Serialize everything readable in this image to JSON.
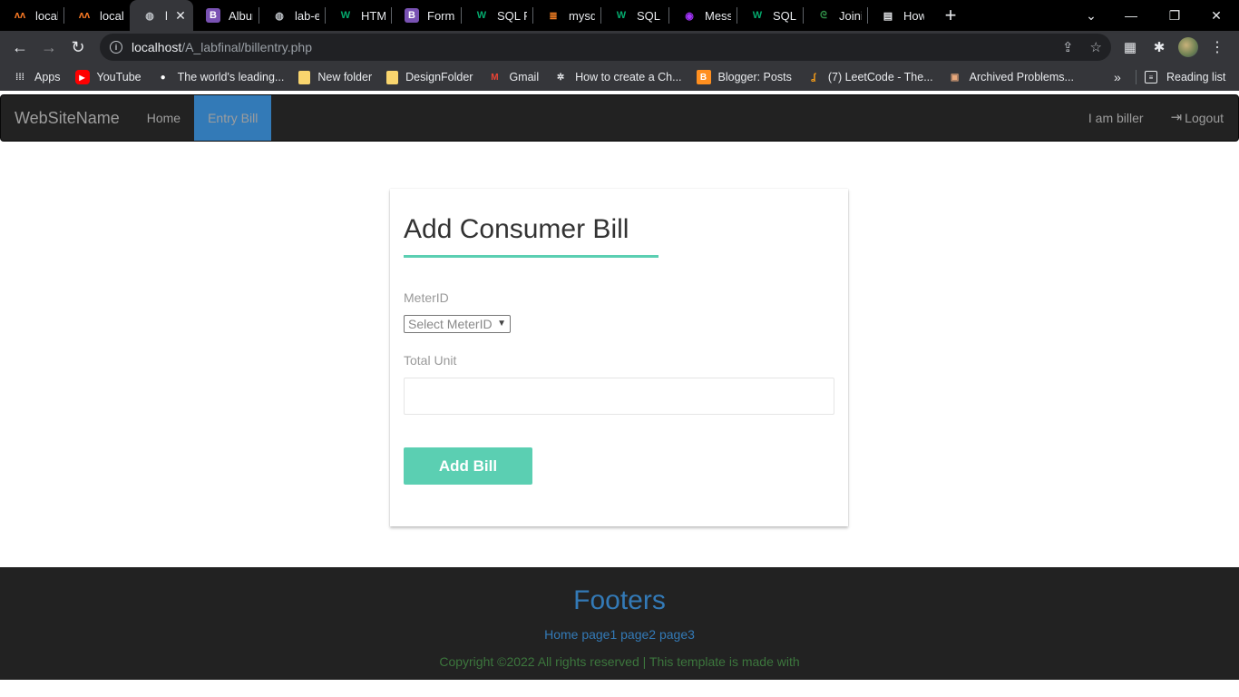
{
  "browser": {
    "tabs": [
      {
        "title": "localhc",
        "icon": "xampp-icon",
        "icon_color": "#fb7a24",
        "active": false
      },
      {
        "title": "localhc",
        "icon": "xampp-icon",
        "icon_color": "#fb7a24",
        "active": false
      },
      {
        "title": "lab",
        "icon": "globe-icon",
        "icon_color": "#bdc1c6",
        "active": true
      },
      {
        "title": "Album",
        "icon": "bootstrap-icon",
        "icon_color": "#7952b3",
        "active": false
      },
      {
        "title": "lab-exa",
        "icon": "globe-icon",
        "icon_color": "#bdc1c6",
        "active": false
      },
      {
        "title": "HTML t",
        "icon": "w3schools-icon",
        "icon_color": "#04aa6d",
        "active": false
      },
      {
        "title": "Forms",
        "icon": "bootstrap-icon",
        "icon_color": "#7952b3",
        "active": false
      },
      {
        "title": "SQL FC",
        "icon": "w3schools-icon",
        "icon_color": "#04aa6d",
        "active": false
      },
      {
        "title": "mysql",
        "icon": "stackoverflow-icon",
        "icon_color": "#f48024",
        "active": false
      },
      {
        "title": "SQL IN",
        "icon": "w3schools-icon",
        "icon_color": "#04aa6d",
        "active": false
      },
      {
        "title": "Messe",
        "icon": "messenger-icon",
        "icon_color": "#a334fa",
        "active": false
      },
      {
        "title": "SQL FU",
        "icon": "w3schools-icon",
        "icon_color": "#04aa6d",
        "active": false
      },
      {
        "title": "Joining",
        "icon": "geeksforgeeks-icon",
        "icon_color": "#2f8d46",
        "active": false
      },
      {
        "title": "How tc",
        "icon": "terminal-icon",
        "icon_color": "#e8eaed",
        "active": false
      }
    ],
    "url_host": "localhost",
    "url_path": "/A_labfinal/billentry.php",
    "bookmarks": [
      {
        "label": "Apps",
        "icon": "apps-grid-icon",
        "icon_color": "#e8eaed"
      },
      {
        "label": "YouTube",
        "icon": "youtube-icon",
        "icon_color": "#ff0000"
      },
      {
        "label": "The world's leading...",
        "icon": "github-icon",
        "icon_color": "#ffffff"
      },
      {
        "label": "New folder",
        "icon": "folder-icon",
        "icon_color": "#f9d56e"
      },
      {
        "label": "DesignFolder",
        "icon": "folder-icon",
        "icon_color": "#f9d56e"
      },
      {
        "label": "Gmail",
        "icon": "gmail-icon",
        "icon_color": "#ea4335"
      },
      {
        "label": "How to create a Ch...",
        "icon": "chrome-webstore-icon",
        "icon_color": "#e8eaed"
      },
      {
        "label": "Blogger: Posts",
        "icon": "blogger-icon",
        "icon_color": "#ff8f1f"
      },
      {
        "label": "(7) LeetCode - The...",
        "icon": "leetcode-icon",
        "icon_color": "#ffa116"
      },
      {
        "label": "Archived Problems...",
        "icon": "archive-icon",
        "icon_color": "#e8a87c"
      }
    ],
    "bookmarks_more": "»",
    "reading_list": "Reading list"
  },
  "navbar": {
    "brand": "WebSiteName",
    "links": [
      {
        "label": "Home",
        "active": false
      },
      {
        "label": "Entry Bill",
        "active": true
      }
    ],
    "right": {
      "user": "I am biller",
      "logout": "Logout"
    }
  },
  "form": {
    "title": "Add Consumer Bill",
    "meter_label": "MeterID",
    "meter_selected": "Select MeterID",
    "unit_label": "Total Unit",
    "unit_value": "",
    "submit_label": "Add Bill"
  },
  "footer": {
    "title": "Footers",
    "links": "Home page1 page2 page3",
    "copyright": "Copyright ©2022 All rights reserved | This template is made with"
  }
}
